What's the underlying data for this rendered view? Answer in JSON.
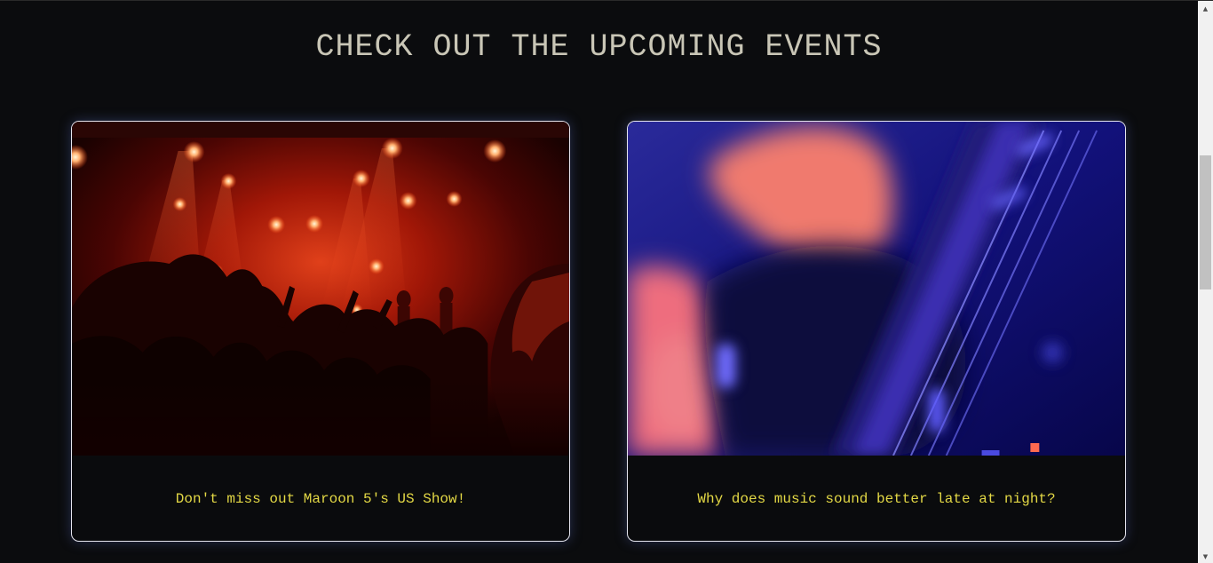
{
  "page": {
    "heading": "CHECK OUT THE UPCOMING EVENTS"
  },
  "events": [
    {
      "caption": "Don't miss out Maroon 5's US Show!",
      "image": "red-concert-crowd-photo"
    },
    {
      "caption": "Why does music sound better late at night?",
      "image": "blue-blurred-guitar-photo"
    }
  ],
  "colors": {
    "background": "#0b0c0e",
    "heading": "#c9c6b6",
    "caption": "#e3d845",
    "card_border": "#e6e6ef"
  },
  "scrollbar": {
    "up_icon": "scroll-up-arrow-icon",
    "down_icon": "scroll-down-arrow-icon"
  }
}
